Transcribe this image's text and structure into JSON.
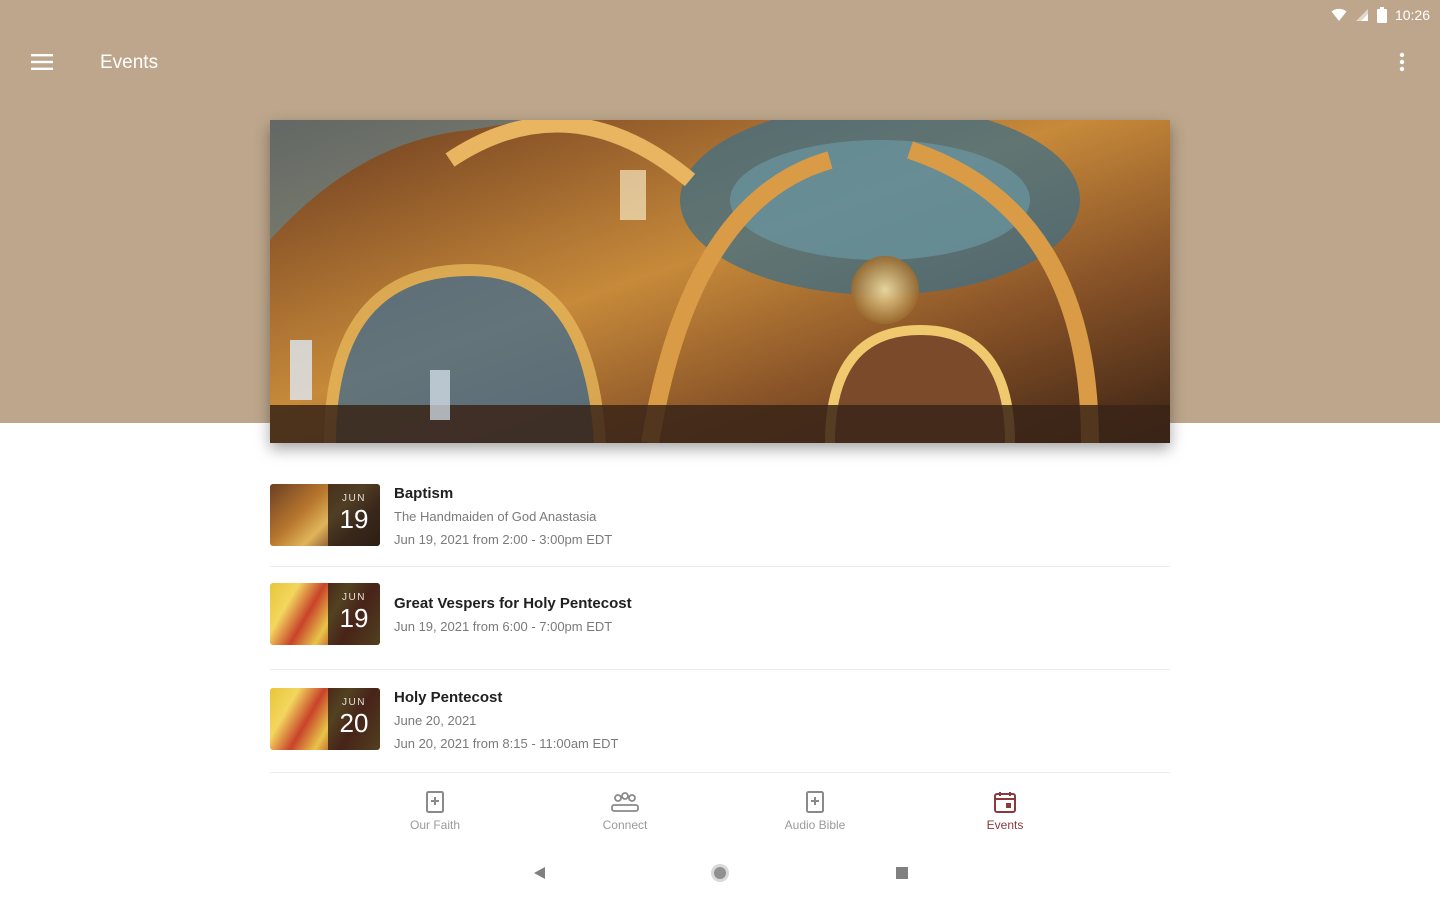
{
  "status_bar": {
    "time": "10:26",
    "wifi_icon": "wifi-icon",
    "signal_icon": "signal-icon",
    "battery_icon": "battery-icon"
  },
  "app_bar": {
    "title": "Events",
    "menu_icon": "menu-icon",
    "overflow_icon": "more-vert-icon"
  },
  "colors": {
    "header_bg": "#bda68b",
    "accent": "#8a3a3a",
    "title_text": "#202020",
    "sub_text": "#7a7a7a"
  },
  "events": [
    {
      "month": "JUN",
      "day": "19",
      "title": "Baptism",
      "subtitle": "The Handmaiden of God Anastasia",
      "time": "Jun 19, 2021 from 2:00 - 3:00pm EDT"
    },
    {
      "month": "JUN",
      "day": "19",
      "title": "Great Vespers for Holy Pentecost",
      "time": "Jun 19, 2021 from 6:00 - 7:00pm EDT"
    },
    {
      "month": "JUN",
      "day": "20",
      "title": "Holy Pentecost",
      "subtitle": "June 20, 2021",
      "time": "Jun 20, 2021 from 8:15 - 11:00am EDT"
    }
  ],
  "bottom_nav": {
    "items": [
      {
        "label": "Our Faith",
        "icon": "book-plus-icon",
        "active": false
      },
      {
        "label": "Connect",
        "icon": "group-icon",
        "active": false
      },
      {
        "label": "Audio Bible",
        "icon": "book-plus-icon",
        "active": false
      },
      {
        "label": "Events",
        "icon": "calendar-icon",
        "active": true
      }
    ]
  },
  "system_nav": {
    "back_icon": "back-triangle-icon",
    "home_icon": "home-circle-icon",
    "recents_icon": "recents-square-icon"
  }
}
